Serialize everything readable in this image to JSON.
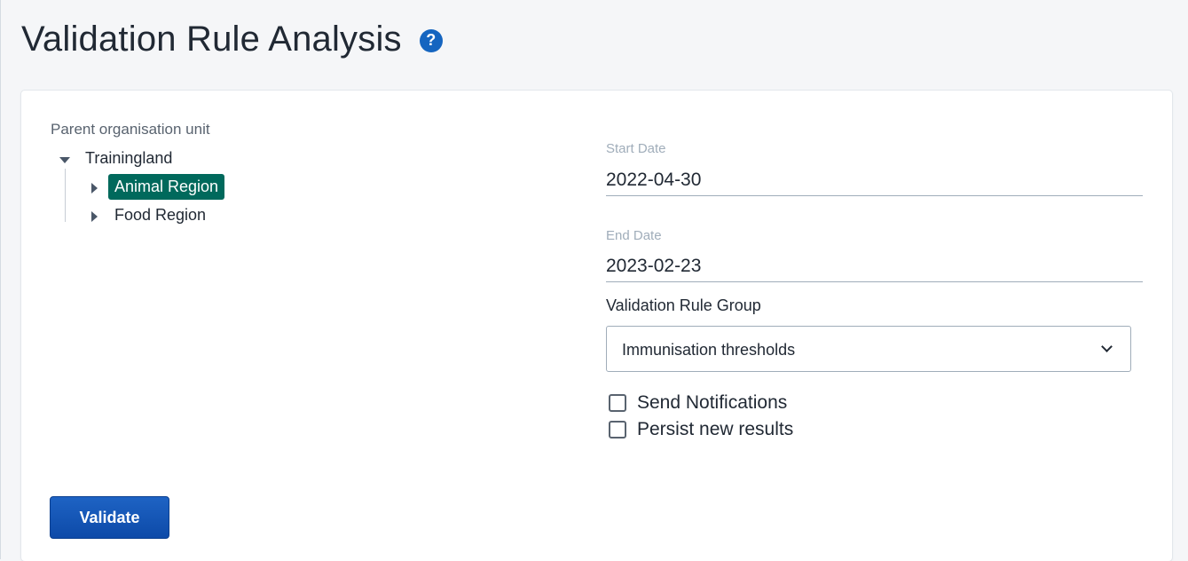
{
  "page": {
    "title": "Validation Rule Analysis",
    "help_icon": "?"
  },
  "org_unit": {
    "label": "Parent organisation unit",
    "root": "Trainingland",
    "children": [
      {
        "label": "Animal Region",
        "selected": true
      },
      {
        "label": "Food Region",
        "selected": false
      }
    ]
  },
  "start_date": {
    "label": "Start Date",
    "value": "2022-04-30"
  },
  "end_date": {
    "label": "End Date",
    "value": "2023-02-23"
  },
  "rule_group": {
    "label": "Validation Rule Group",
    "value": "Immunisation thresholds"
  },
  "options": {
    "send_notifications": {
      "label": "Send Notifications",
      "checked": false
    },
    "persist_results": {
      "label": "Persist new results",
      "checked": false
    }
  },
  "actions": {
    "validate_label": "Validate"
  },
  "colors": {
    "accent_blue": "#1565c0",
    "selected_green": "#00695c"
  }
}
